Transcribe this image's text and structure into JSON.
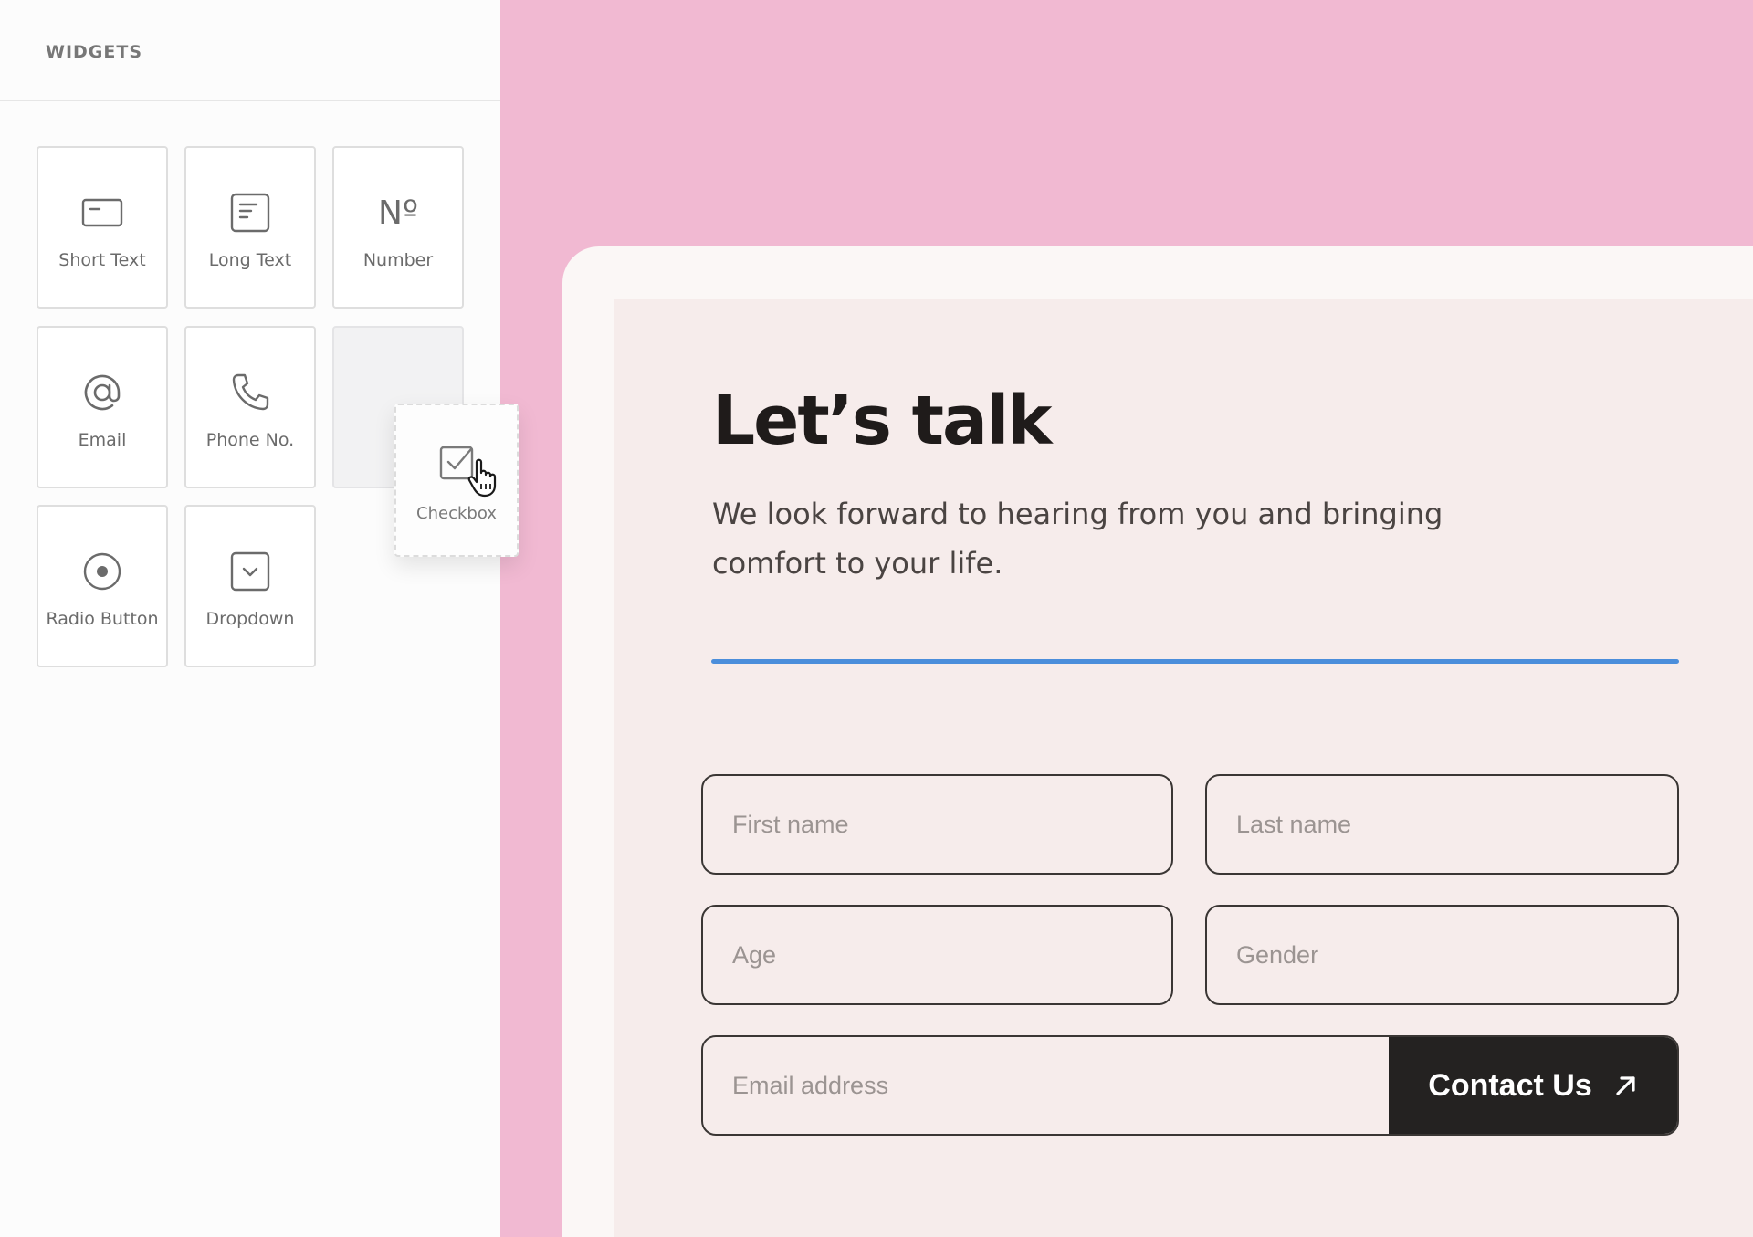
{
  "sidebar": {
    "title": "WIDGETS",
    "widgets": [
      {
        "label": "Short Text",
        "icon": "short-text-icon"
      },
      {
        "label": "Long Text",
        "icon": "long-text-icon"
      },
      {
        "label": "Number",
        "icon": "number-icon",
        "glyph": "Nº"
      },
      {
        "label": "Email",
        "icon": "at-sign-icon"
      },
      {
        "label": "Phone No.",
        "icon": "phone-icon"
      },
      {
        "label": "Radio Button",
        "icon": "radio-icon"
      },
      {
        "label": "Dropdown",
        "icon": "dropdown-icon"
      }
    ],
    "dragging": {
      "label": "Checkbox",
      "icon": "checkbox-icon"
    }
  },
  "form": {
    "title": "Let’s talk",
    "subtitle": "We look forward to hearing from you and bringing comfort to your life.",
    "first_name_placeholder": "First name",
    "last_name_placeholder": "Last name",
    "age_placeholder": "Age",
    "gender_placeholder": "Gender",
    "email_placeholder": "Email address",
    "submit_label": "Contact Us"
  },
  "colors": {
    "canvas_pink": "#f1b9d2",
    "card": "#f6eceb",
    "accent_line": "#4b8edb",
    "button": "#242221"
  }
}
